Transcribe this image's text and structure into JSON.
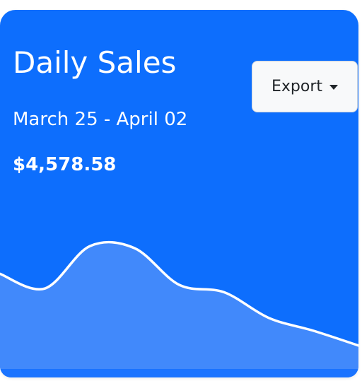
{
  "card": {
    "title": "Daily Sales",
    "date_range": "March 25 - April 02",
    "total": "$4,578.58",
    "export_label": "Export",
    "export_icon": "caret-down-icon",
    "colors": {
      "card_background": "#0d6efd",
      "area_fill": "#4189fb",
      "line": "#ffffff",
      "button_background": "#f8f9fa",
      "button_text": "#212529"
    }
  },
  "chart_data": {
    "type": "area",
    "series": [
      {
        "values": [
          0.41,
          0.33,
          0.56,
          0.55,
          0.35,
          0.31,
          0.17,
          0.1,
          0.02
        ]
      }
    ],
    "xlabel": "",
    "ylabel": "",
    "grid": false,
    "ylim": [
      0,
      1
    ]
  }
}
